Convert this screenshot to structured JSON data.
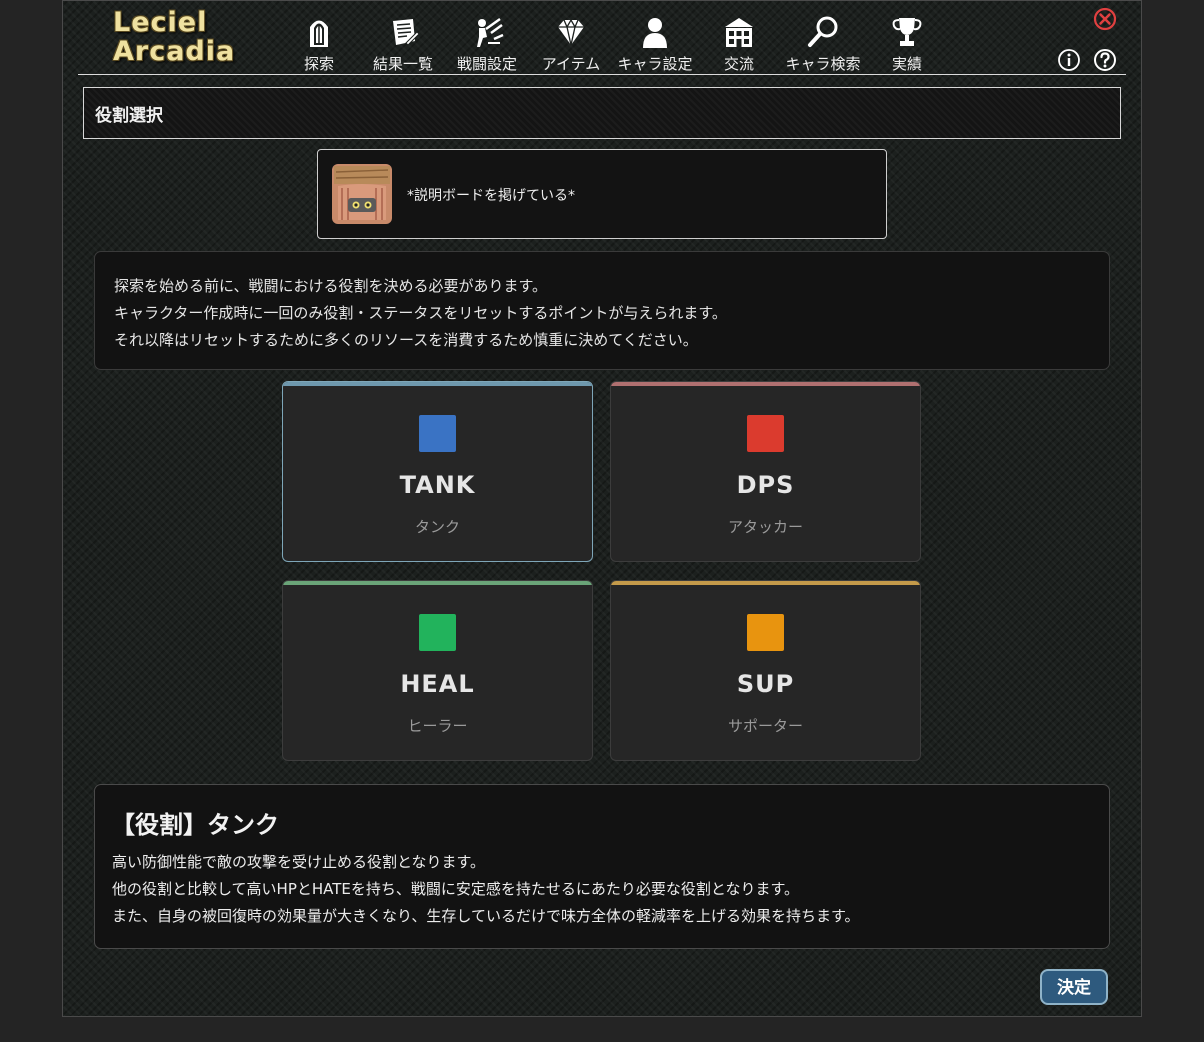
{
  "logo": {
    "line1": "Leciel",
    "line2": "Arcadia"
  },
  "nav": {
    "items": [
      {
        "label": "探索",
        "icon": "door-icon"
      },
      {
        "label": "結果一覧",
        "icon": "scroll-icon"
      },
      {
        "label": "戦闘設定",
        "icon": "battle-icon"
      },
      {
        "label": "アイテム",
        "icon": "gem-icon"
      },
      {
        "label": "キャラ設定",
        "icon": "person-icon"
      },
      {
        "label": "交流",
        "icon": "building-icon"
      },
      {
        "label": "キャラ検索",
        "icon": "magnifier-icon"
      },
      {
        "label": "実績",
        "icon": "trophy-icon"
      }
    ]
  },
  "page": {
    "title": "役割選択"
  },
  "npc": {
    "message": "*説明ボードを掲げている*"
  },
  "description": {
    "lines": [
      "探索を始める前に、戦闘における役割を決める必要があります。",
      "キャラクター作成時に一回のみ役割・ステータスをリセットするポイントが与えられます。",
      "それ以降はリセットするために多くのリソースを消費するため慎重に決めてください。"
    ]
  },
  "roles": [
    {
      "name": "TANK",
      "sub": "タンク",
      "color": "#3a73c4",
      "accent": "#6e98ad",
      "selected": true
    },
    {
      "name": "DPS",
      "sub": "アタッカー",
      "color": "#db3b2e",
      "accent": "#b07070",
      "selected": false
    },
    {
      "name": "HEAL",
      "sub": "ヒーラー",
      "color": "#22b35c",
      "accent": "#6aa478",
      "selected": false
    },
    {
      "name": "SUP",
      "sub": "サポーター",
      "color": "#e8940f",
      "accent": "#c49a4a",
      "selected": false
    }
  ],
  "detail": {
    "heading": "【役割】タンク",
    "lines": [
      "高い防御性能で敵の攻撃を受け止める役割となります。",
      "他の役割と比較して高いHPとHATEを持ち、戦闘に安定感を持たせるにあたり必要な役割となります。",
      "また、自身の被回復時の効果量が大きくなり、生存しているだけで味方全体の軽減率を上げる効果を持ちます。"
    ]
  },
  "submit": {
    "label": "決定"
  }
}
